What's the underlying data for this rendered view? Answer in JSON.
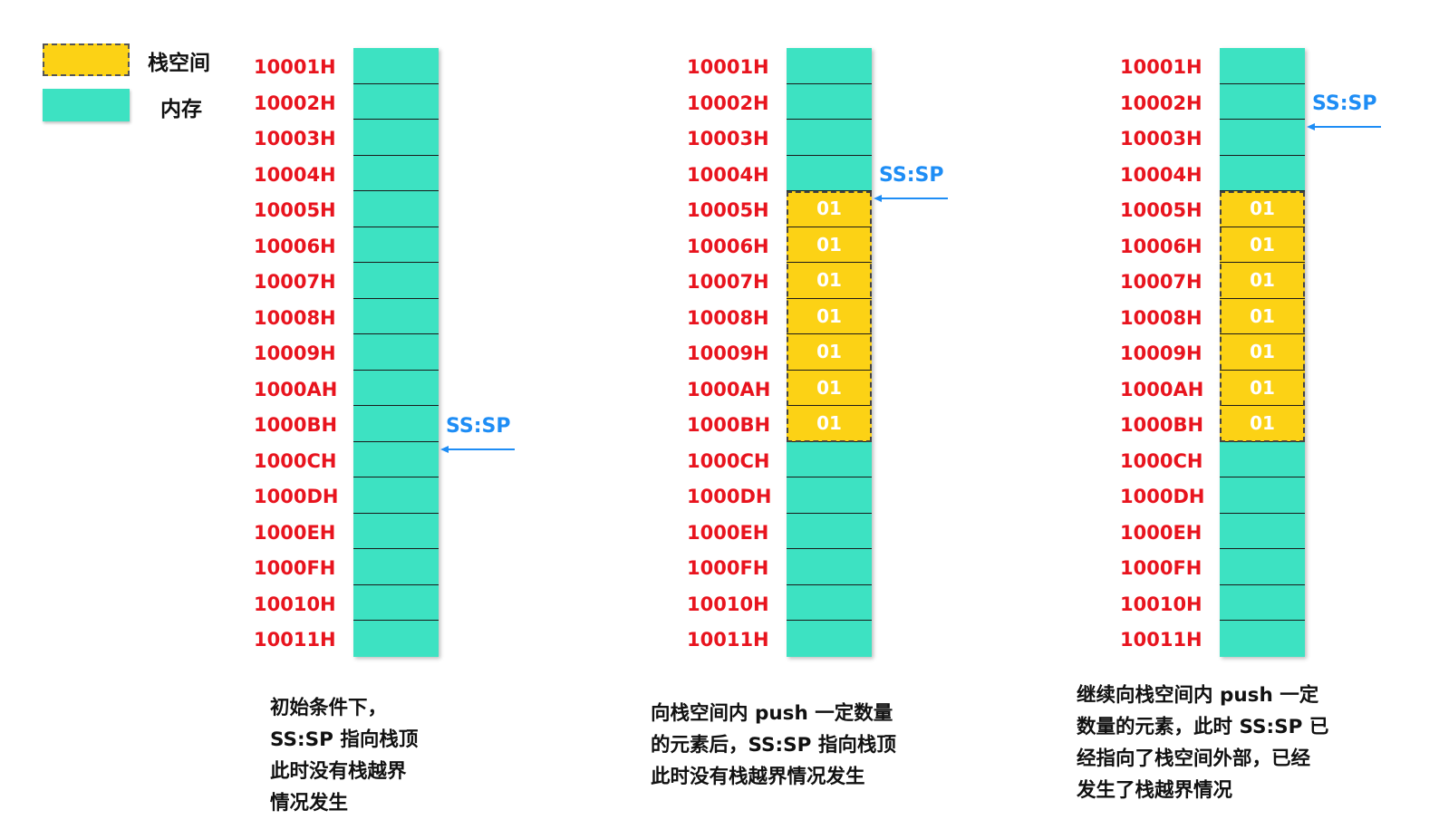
{
  "legend": {
    "stack_label": "栈空间",
    "memory_label": "内存"
  },
  "colors": {
    "memory": "#3de2c2",
    "stack": "#fcd215",
    "address": "#e8141e",
    "pointer": "#1e8df5"
  },
  "addresses": [
    "10001H",
    "10002H",
    "10003H",
    "10004H",
    "10005H",
    "10006H",
    "10007H",
    "10008H",
    "10009H",
    "1000AH",
    "1000BH",
    "1000CH",
    "1000DH",
    "1000EH",
    "1000FH",
    "10010H",
    "10011H"
  ],
  "pointer_label": "SS:SP",
  "stack_value": "01",
  "panels": [
    {
      "stack_rows": [],
      "pointer_address": "1000CH",
      "caption": [
        "初始条件下，",
        "SS:SP 指向栈顶",
        "此时没有栈越界",
        "情况发生"
      ]
    },
    {
      "stack_rows": [
        4,
        5,
        6,
        7,
        8,
        9,
        10
      ],
      "pointer_address": "10005H",
      "caption": [
        "向栈空间内 push 一定数量",
        "的元素后，SS:SP 指向栈顶",
        "此时没有栈越界情况发生"
      ]
    },
    {
      "stack_rows": [
        4,
        5,
        6,
        7,
        8,
        9,
        10
      ],
      "pointer_address": "10003H",
      "caption": [
        "继续向栈空间内 push 一定",
        "数量的元素，此时 SS:SP 已",
        "经指向了栈空间外部，已经",
        "发生了栈越界情况"
      ]
    }
  ]
}
